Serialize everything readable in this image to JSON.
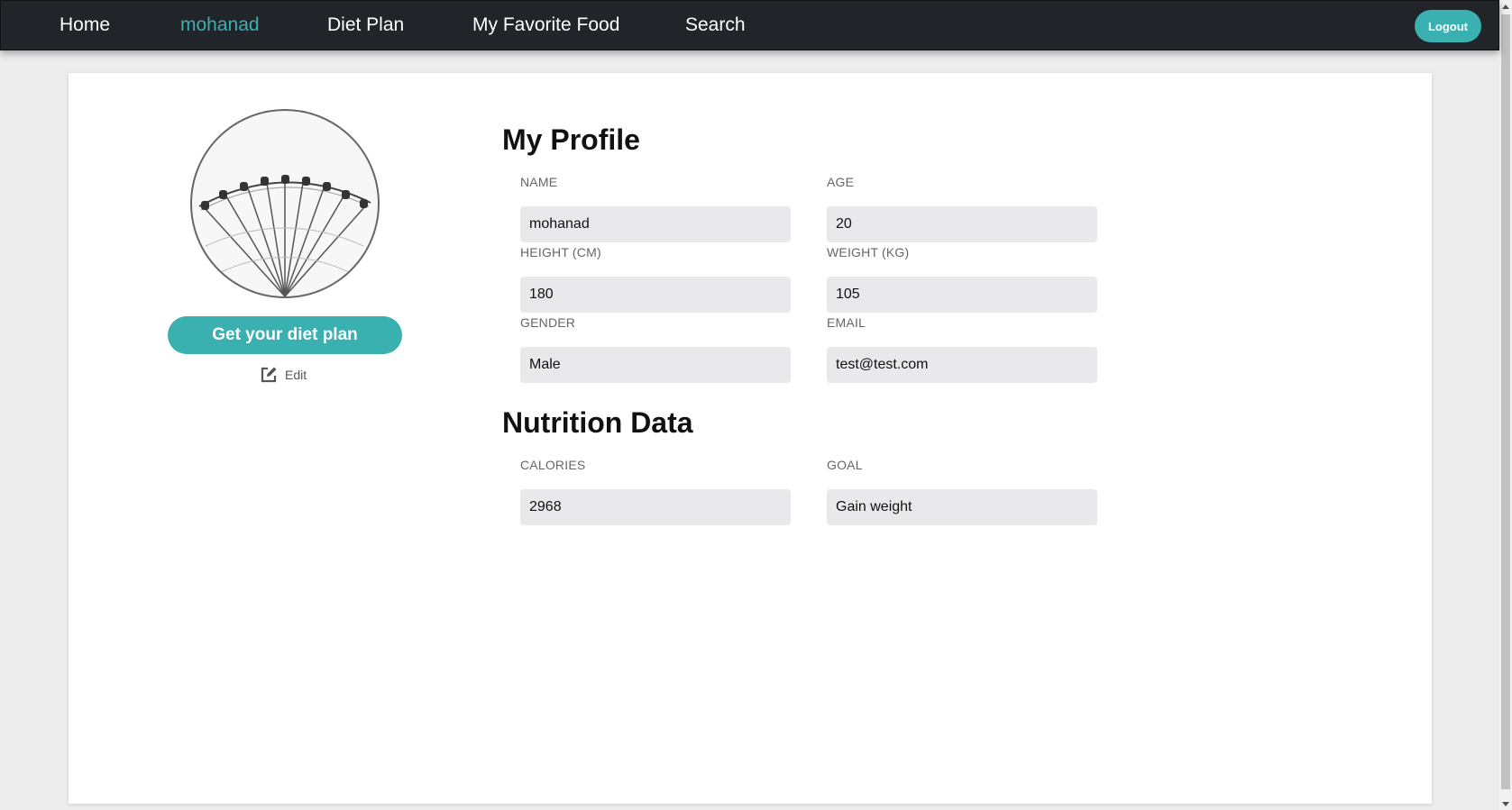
{
  "nav": {
    "items": [
      {
        "label": "Home",
        "active": false
      },
      {
        "label": "mohanad",
        "active": true
      },
      {
        "label": "Diet Plan",
        "active": false
      },
      {
        "label": "My Favorite Food",
        "active": false
      },
      {
        "label": "Search",
        "active": false
      }
    ],
    "logout_label": "Logout"
  },
  "sidebar": {
    "avatar_icon": "profile-avatar-image",
    "diet_button_label": "Get your diet plan",
    "edit_label": "Edit",
    "edit_icon": "edit-icon"
  },
  "profile": {
    "title": "My Profile",
    "fields": [
      {
        "label": "NAME",
        "value": "mohanad"
      },
      {
        "label": "AGE",
        "value": "20"
      },
      {
        "label": "HEIGHT (CM)",
        "value": "180"
      },
      {
        "label": "WEIGHT (KG)",
        "value": "105"
      },
      {
        "label": "GENDER",
        "value": "Male"
      },
      {
        "label": "EMAIL",
        "value": "test@test.com"
      }
    ]
  },
  "nutrition": {
    "title": "Nutrition Data",
    "fields": [
      {
        "label": "CALORIES",
        "value": "2968"
      },
      {
        "label": "GOAL",
        "value": "Gain weight"
      }
    ]
  },
  "colors": {
    "navbar": "#212529",
    "accent": "#3ab0b0",
    "page_bg": "#ededed",
    "input_bg": "#e9e9eb"
  }
}
